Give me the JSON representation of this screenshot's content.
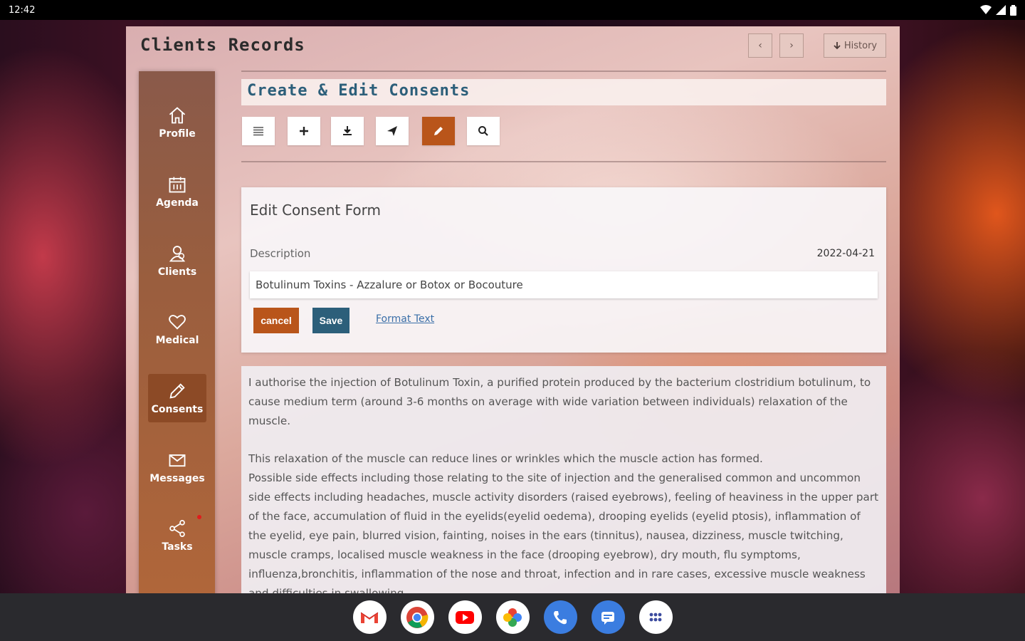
{
  "status_bar": {
    "time": "12:42"
  },
  "app": {
    "title": "Clients Records",
    "prev_label": "‹",
    "next_label": "›",
    "history_label": "History"
  },
  "sidebar": {
    "items": [
      {
        "label": "Profile",
        "icon": "home-icon"
      },
      {
        "label": "Agenda",
        "icon": "calendar-icon"
      },
      {
        "label": "Clients",
        "icon": "client-icon"
      },
      {
        "label": "Medical",
        "icon": "heart-icon"
      },
      {
        "label": "Consents",
        "icon": "pencil-icon",
        "active": true
      },
      {
        "label": "Messages",
        "icon": "envelope-icon"
      },
      {
        "label": "Tasks",
        "icon": "share-icon",
        "badge_dot": true
      }
    ]
  },
  "section": {
    "title": "Create & Edit Consents"
  },
  "toolbar": {
    "tools": [
      "list-icon",
      "plus-icon",
      "download-icon",
      "send-icon",
      "pencil-icon",
      "search-icon"
    ],
    "active_tool": "pencil-icon"
  },
  "form": {
    "title": "Edit Consent Form",
    "description_label": "Description",
    "date": "2022-04-21",
    "description_value": "Botulinum Toxins - Azzalure or Botox or Bocouture",
    "cancel_label": "cancel",
    "save_label": "Save",
    "format_link": "Format Text"
  },
  "consent_text": {
    "paragraph1": "I authorise the injection of Botulinum Toxin, a purified protein produced by the bacterium clostridium botulinum, to cause medium term (around 3-6 months on average with wide variation between individuals) relaxation of the muscle.",
    "paragraph2": "This relaxation of the muscle can reduce lines or wrinkles which the muscle action has formed.",
    "paragraph3": "Possible side effects including those relating to the site of injection and the generalised common and uncommon side effects including headaches, muscle activity disorders (raised eyebrows), feeling of heaviness in the upper part of the face, accumulation of fluid in the eyelids(eyelid oedema), drooping eyelids (eyelid ptosis), inflammation of the eyelid, eye pain, blurred vision, fainting, noises in the ears (tinnitus), nausea, dizziness, muscle twitching, muscle cramps, localised muscle weakness in the face (drooping eyebrow), dry mouth, flu symptoms, influenza,bronchitis, inflammation of the nose and throat, infection and in rare cases, excessive muscle weakness and difficulties in swallowing."
  },
  "dock": {
    "apps": [
      "gmail-icon",
      "chrome-icon",
      "youtube-icon",
      "photos-icon",
      "phone-icon",
      "messages-icon",
      "app-drawer-icon"
    ]
  }
}
